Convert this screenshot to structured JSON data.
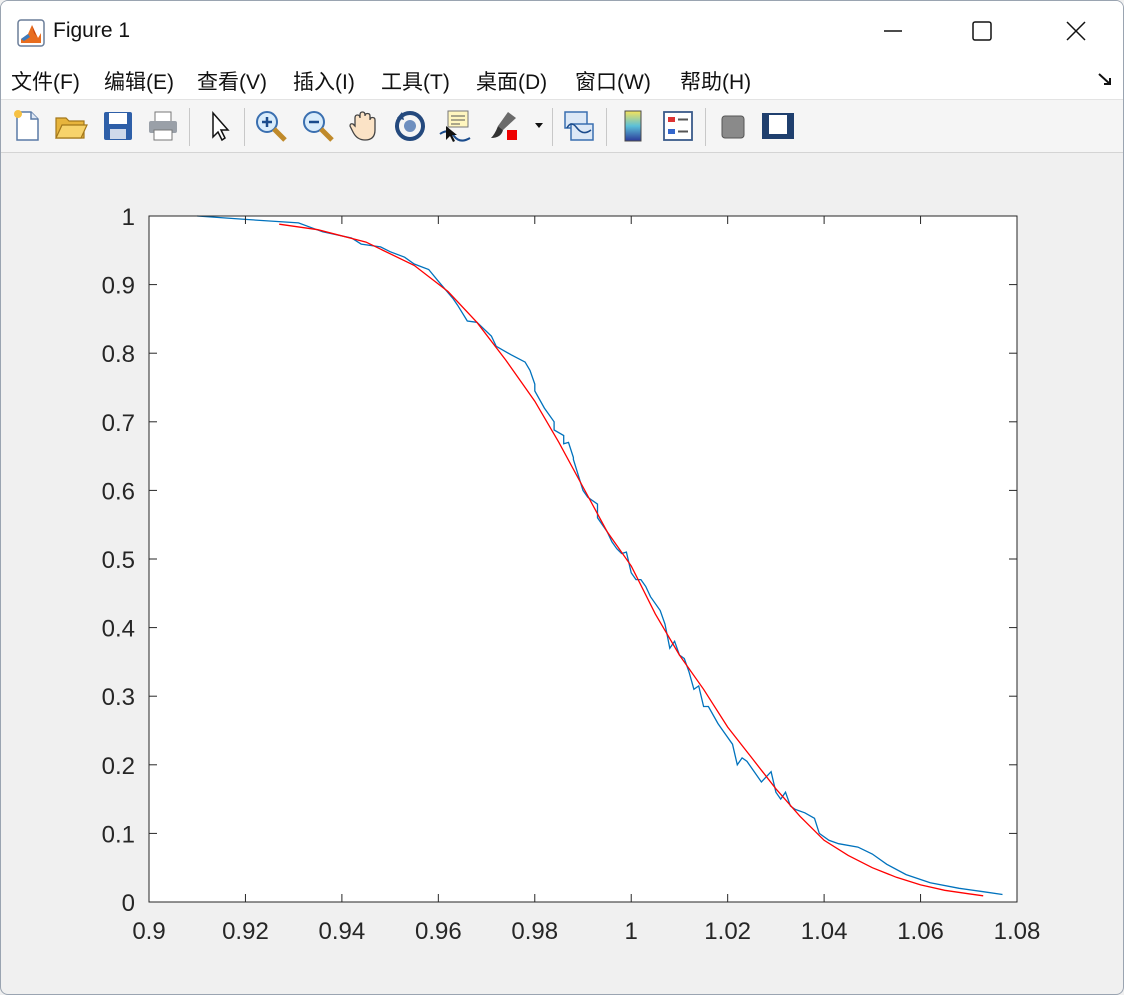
{
  "window": {
    "title": "Figure 1"
  },
  "menu": [
    "文件(F)",
    "编辑(E)",
    "查看(V)",
    "插入(I)",
    "工具(T)",
    "桌面(D)",
    "窗口(W)",
    "帮助(H)"
  ],
  "toolbar": [
    "new-figure-icon",
    "open-file-icon",
    "save-icon",
    "print-icon",
    "select-arrow-icon",
    "zoom-in-icon",
    "zoom-out-icon",
    "pan-hand-icon",
    "rotate-3d-icon",
    "data-cursor-icon",
    "brush-icon",
    "link-plot-icon",
    "colorbar-icon",
    "legend-icon",
    "hide-plot-tools-icon",
    "show-plot-tools-icon"
  ],
  "colors": {
    "empirical": "#0072BD",
    "fit": "#FF0000"
  },
  "chart_data": {
    "type": "line",
    "xlim": [
      0.9,
      1.08
    ],
    "ylim": [
      0,
      1
    ],
    "xticks": [
      0.9,
      0.92,
      0.94,
      0.96,
      0.98,
      1,
      1.02,
      1.04,
      1.06,
      1.08
    ],
    "yticks": [
      0,
      0.1,
      0.2,
      0.3,
      0.4,
      0.5,
      0.6,
      0.7,
      0.8,
      0.9,
      1
    ],
    "xtick_labels": [
      "0.9",
      "0.92",
      "0.94",
      "0.96",
      "0.98",
      "1",
      "1.02",
      "1.04",
      "1.06",
      "1.08"
    ],
    "ytick_labels": [
      "0",
      "0.1",
      "0.2",
      "0.3",
      "0.4",
      "0.5",
      "0.6",
      "0.7",
      "0.8",
      "0.9",
      "1"
    ],
    "grid": false,
    "series": [
      {
        "color": "#0072BD",
        "x": [
          0.91,
          0.92,
          0.931,
          0.936,
          0.942,
          0.944,
          0.948,
          0.95,
          0.953,
          0.955,
          0.958,
          0.96,
          0.963,
          0.964,
          0.966,
          0.968,
          0.971,
          0.972,
          0.975,
          0.978,
          0.979,
          0.98,
          0.98,
          0.982,
          0.984,
          0.984,
          0.986,
          0.986,
          0.987,
          0.988,
          0.988,
          0.99,
          0.991,
          0.993,
          0.993,
          0.995,
          0.996,
          0.997,
          0.998,
          0.999,
          1.0,
          1.001,
          1.002,
          1.003,
          1.004,
          1.006,
          1.007,
          1.008,
          1.009,
          1.01,
          1.011,
          1.012,
          1.013,
          1.014,
          1.015,
          1.016,
          1.018,
          1.019,
          1.021,
          1.022,
          1.023,
          1.024,
          1.025,
          1.027,
          1.029,
          1.03,
          1.031,
          1.032,
          1.033,
          1.034,
          1.036,
          1.038,
          1.039,
          1.041,
          1.043,
          1.047,
          1.05,
          1.053,
          1.057,
          1.062,
          1.068,
          1.073,
          1.077
        ],
        "y": [
          1.0,
          0.995,
          0.99,
          0.977,
          0.968,
          0.959,
          0.955,
          0.948,
          0.94,
          0.93,
          0.922,
          0.905,
          0.88,
          0.87,
          0.847,
          0.845,
          0.825,
          0.81,
          0.798,
          0.787,
          0.775,
          0.755,
          0.745,
          0.72,
          0.7,
          0.688,
          0.68,
          0.668,
          0.67,
          0.648,
          0.645,
          0.6,
          0.59,
          0.58,
          0.56,
          0.54,
          0.525,
          0.515,
          0.508,
          0.51,
          0.48,
          0.47,
          0.47,
          0.46,
          0.445,
          0.425,
          0.405,
          0.37,
          0.38,
          0.36,
          0.355,
          0.335,
          0.31,
          0.315,
          0.285,
          0.285,
          0.26,
          0.25,
          0.23,
          0.2,
          0.21,
          0.205,
          0.195,
          0.175,
          0.19,
          0.16,
          0.15,
          0.16,
          0.14,
          0.135,
          0.13,
          0.122,
          0.1,
          0.09,
          0.085,
          0.08,
          0.07,
          0.055,
          0.04,
          0.028,
          0.02,
          0.015,
          0.011
        ]
      },
      {
        "color": "#FF0000",
        "x": [
          0.927,
          0.935,
          0.945,
          0.955,
          0.962,
          0.968,
          0.974,
          0.98,
          0.985,
          0.99,
          0.995,
          1.0,
          1.005,
          1.01,
          1.015,
          1.02,
          1.025,
          1.03,
          1.035,
          1.04,
          1.045,
          1.05,
          1.055,
          1.06,
          1.065,
          1.07,
          1.073
        ],
        "y": [
          0.988,
          0.98,
          0.962,
          0.928,
          0.89,
          0.845,
          0.79,
          0.73,
          0.67,
          0.605,
          0.54,
          0.49,
          0.42,
          0.36,
          0.31,
          0.255,
          0.21,
          0.165,
          0.125,
          0.09,
          0.068,
          0.05,
          0.036,
          0.025,
          0.017,
          0.012,
          0.009
        ]
      }
    ]
  }
}
